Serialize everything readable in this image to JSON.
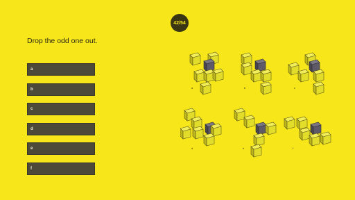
{
  "progress": "42/54",
  "question": "Drop the odd one out.",
  "options": [
    "a",
    "b",
    "c",
    "d",
    "e",
    "f"
  ],
  "figure_labels": [
    "a",
    "b",
    "c",
    "d",
    "e",
    "f"
  ],
  "colors": {
    "background": "#f6e61a",
    "cube": "#e2dd2b",
    "odd_cube": "#5a5560",
    "button": "#4d4a39"
  }
}
